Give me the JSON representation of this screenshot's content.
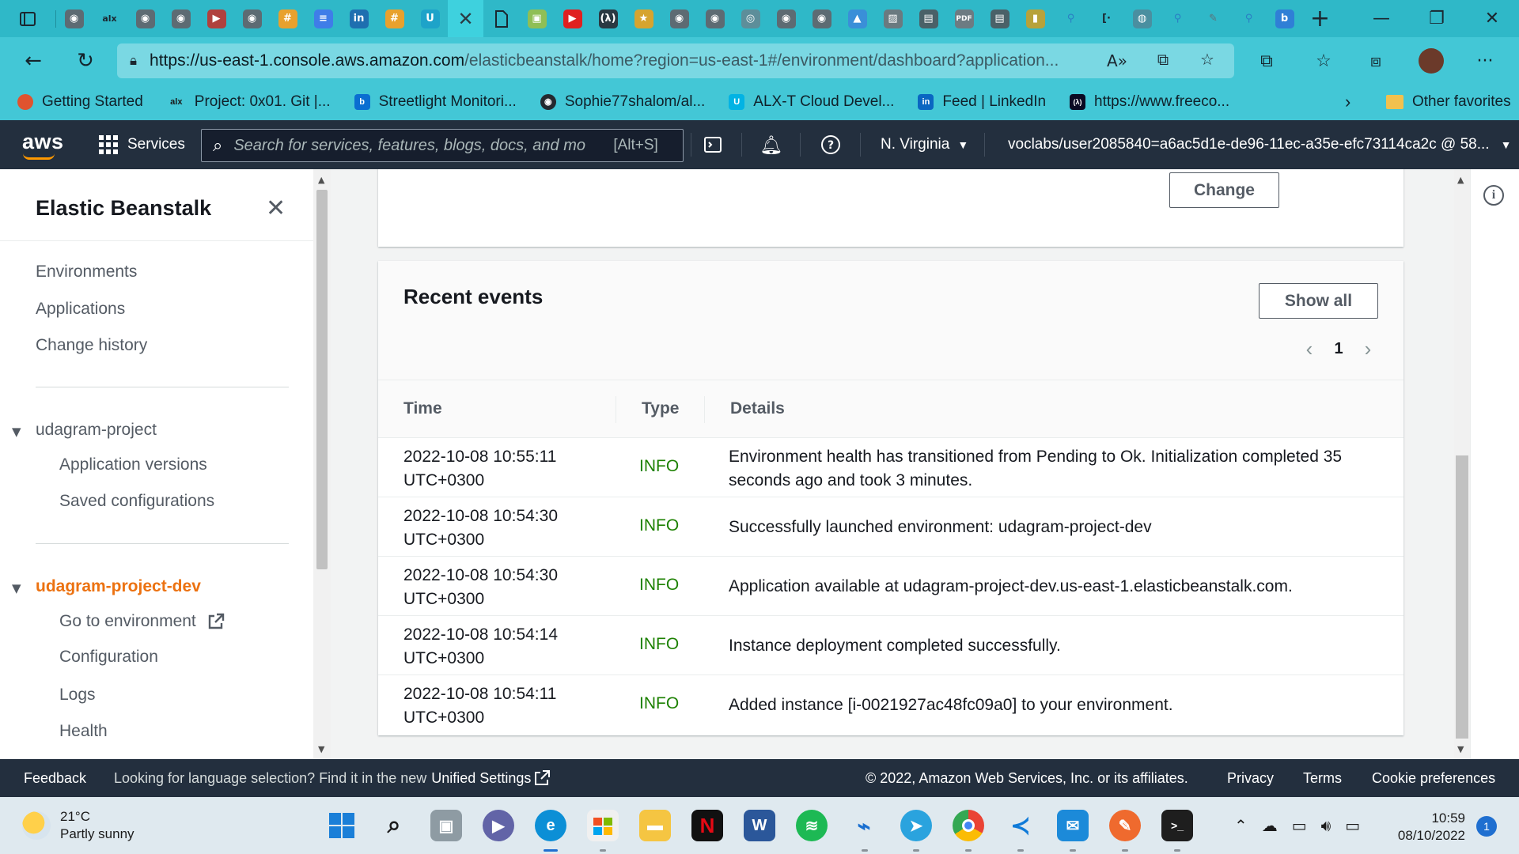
{
  "browser": {
    "url_host": "https://us-east-1.console.aws.amazon.com",
    "url_rest": "/elasticbeanstalk/home?region=us-east-1#/environment/dashboard?application...",
    "bookmarks": [
      {
        "label": "Getting Started",
        "icon": "getting-started-icon",
        "color": "#e0532f"
      },
      {
        "label": "Project: 0x01. Git |...",
        "icon": "alx-icon",
        "color": "#1a1a1a"
      },
      {
        "label": "Streetlight Monitori...",
        "icon": "azure-icon",
        "color": "#0a6ed1"
      },
      {
        "label": "Sophie77shalom/al...",
        "icon": "github-icon",
        "color": "#24292f"
      },
      {
        "label": "ALX-T Cloud Devel...",
        "icon": "udacity-icon",
        "color": "#02b3e4"
      },
      {
        "label": "Feed | LinkedIn",
        "icon": "linkedin-icon",
        "color": "#0a66c2"
      },
      {
        "label": "https://www.freeco...",
        "icon": "freecodecamp-icon",
        "color": "#0a0a23"
      }
    ],
    "other_favorites": "Other favorites"
  },
  "aws_nav": {
    "logo": "aws",
    "services": "Services",
    "search_placeholder": "Search for services, features, blogs, docs, and mo",
    "search_shortcut": "[Alt+S]",
    "region": "N. Virginia",
    "account": "voclabs/user2085840=a6ac5d1e-de96-11ec-a35e-efc73114ca2c @ 58..."
  },
  "sidebar": {
    "title": "Elastic Beanstalk",
    "top_links": [
      "Environments",
      "Applications",
      "Change history"
    ],
    "app_section": "udagram-project",
    "app_links": [
      "Application versions",
      "Saved configurations"
    ],
    "env_section": "udagram-project-dev",
    "env_links": [
      "Go to environment",
      "Configuration",
      "Logs",
      "Health"
    ]
  },
  "top_card": {
    "change_button": "Change"
  },
  "events": {
    "title": "Recent events",
    "show_all": "Show all",
    "page": "1",
    "columns": [
      "Time",
      "Type",
      "Details"
    ],
    "rows": [
      {
        "time": "2022-10-08 10:55:11 UTC+0300",
        "type": "INFO",
        "details": "Environment health has transitioned from Pending to Ok. Initialization completed 35 seconds ago and took 3 minutes."
      },
      {
        "time": "2022-10-08 10:54:30 UTC+0300",
        "type": "INFO",
        "details": "Successfully launched environment: udagram-project-dev"
      },
      {
        "time": "2022-10-08 10:54:30 UTC+0300",
        "type": "INFO",
        "details": "Application available at udagram-project-dev.us-east-1.elasticbeanstalk.com."
      },
      {
        "time": "2022-10-08 10:54:14 UTC+0300",
        "type": "INFO",
        "details": "Instance deployment completed successfully."
      },
      {
        "time": "2022-10-08 10:54:11 UTC+0300",
        "type": "INFO",
        "details": "Added instance [i-0021927ac48fc09a0] to your environment."
      }
    ]
  },
  "footer": {
    "feedback": "Feedback",
    "language_prompt": "Looking for language selection? Find it in the new",
    "unified_settings": "Unified Settings",
    "copyright": "© 2022, Amazon Web Services, Inc. or its affiliates.",
    "privacy": "Privacy",
    "terms": "Terms",
    "cookie": "Cookie preferences"
  },
  "taskbar": {
    "temperature": "21°C",
    "weather": "Partly sunny",
    "time": "10:59",
    "date": "08/10/2022",
    "notifications": "1"
  },
  "colors": {
    "aws_nav": "#232f3e",
    "aws_orange": "#ec7211",
    "info_green": "#1d8102",
    "browser_teal": "#43c7d6"
  }
}
